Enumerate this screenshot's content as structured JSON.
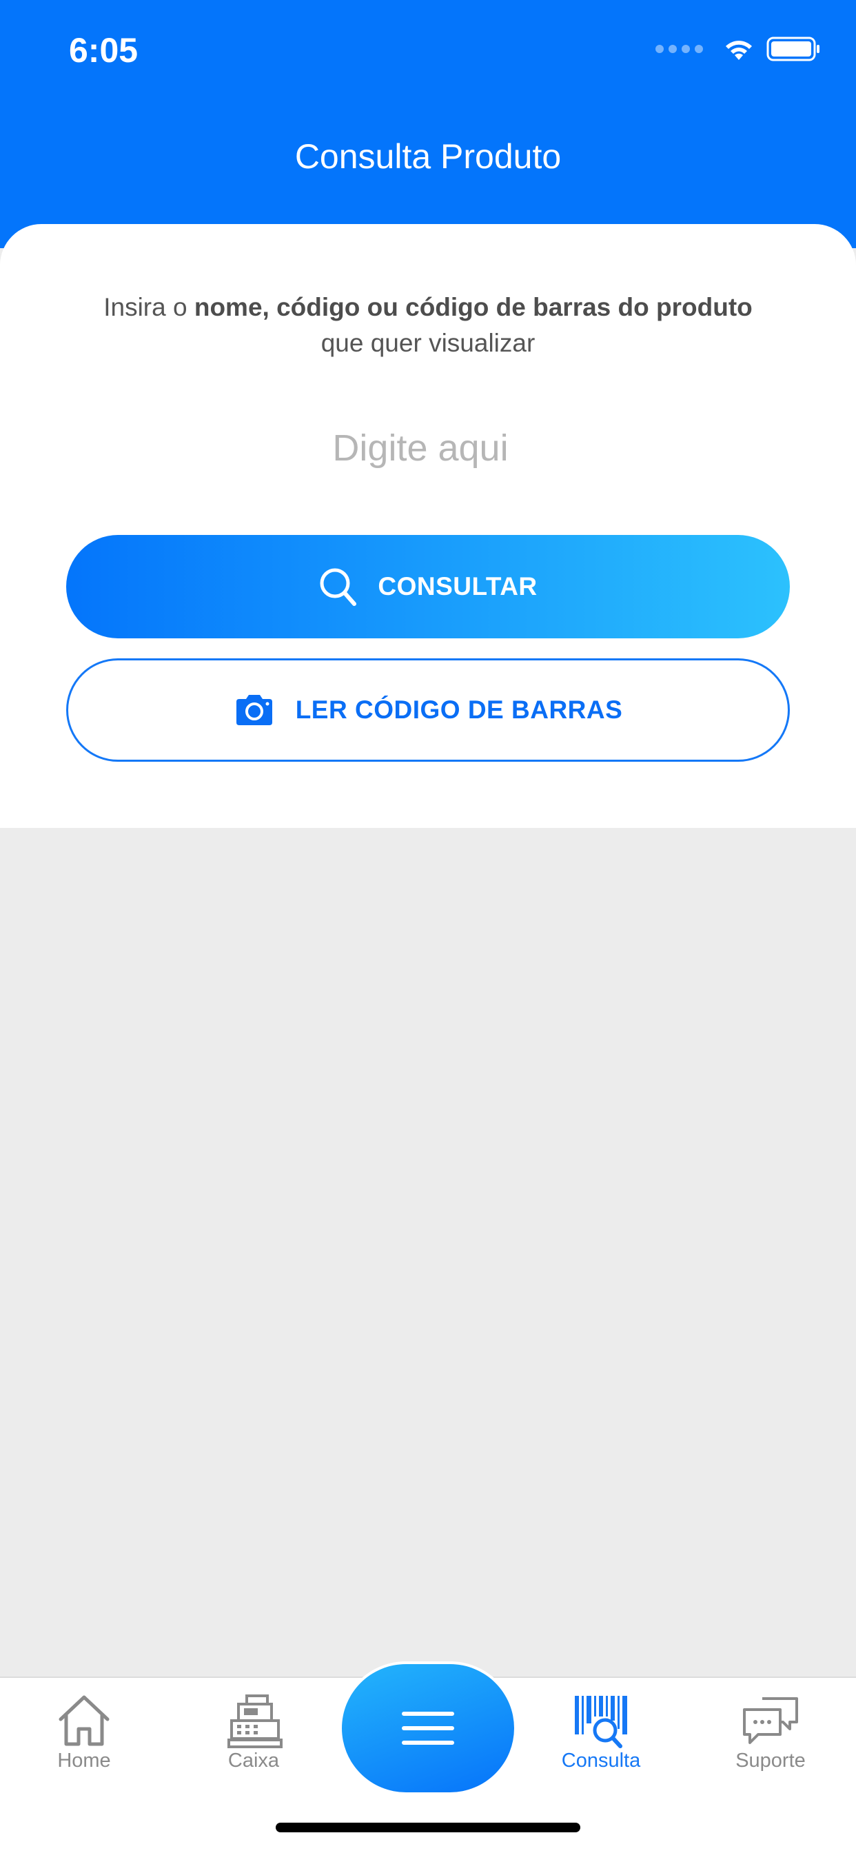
{
  "status_bar": {
    "time": "6:05"
  },
  "header": {
    "title": "Consulta Produto"
  },
  "instruction": {
    "prefix": "Insira o",
    "bold": "nome, código ou código de barras do produto",
    "suffix": "que quer visualizar"
  },
  "search": {
    "placeholder": "Digite aqui",
    "value": ""
  },
  "buttons": {
    "consultar": {
      "label": "CONSULTAR",
      "icon": "search-icon"
    },
    "ler_codigo": {
      "label": "LER CÓDIGO DE BARRAS",
      "icon": "camera-icon"
    }
  },
  "tabs": [
    {
      "label": "Home",
      "icon": "home-icon",
      "active": false
    },
    {
      "label": "Caixa",
      "icon": "cash-register-icon",
      "active": false
    },
    {
      "label": "Consulta",
      "icon": "barcode-search-icon",
      "active": true
    },
    {
      "label": "Suporte",
      "icon": "chat-support-icon",
      "active": false
    }
  ],
  "center_button": {
    "icon": "menu-icon"
  },
  "colors": {
    "primary": "#0475fb",
    "gradient_end": "#2cc1fd",
    "background": "#ececec",
    "inactive": "#8a8a8a"
  }
}
